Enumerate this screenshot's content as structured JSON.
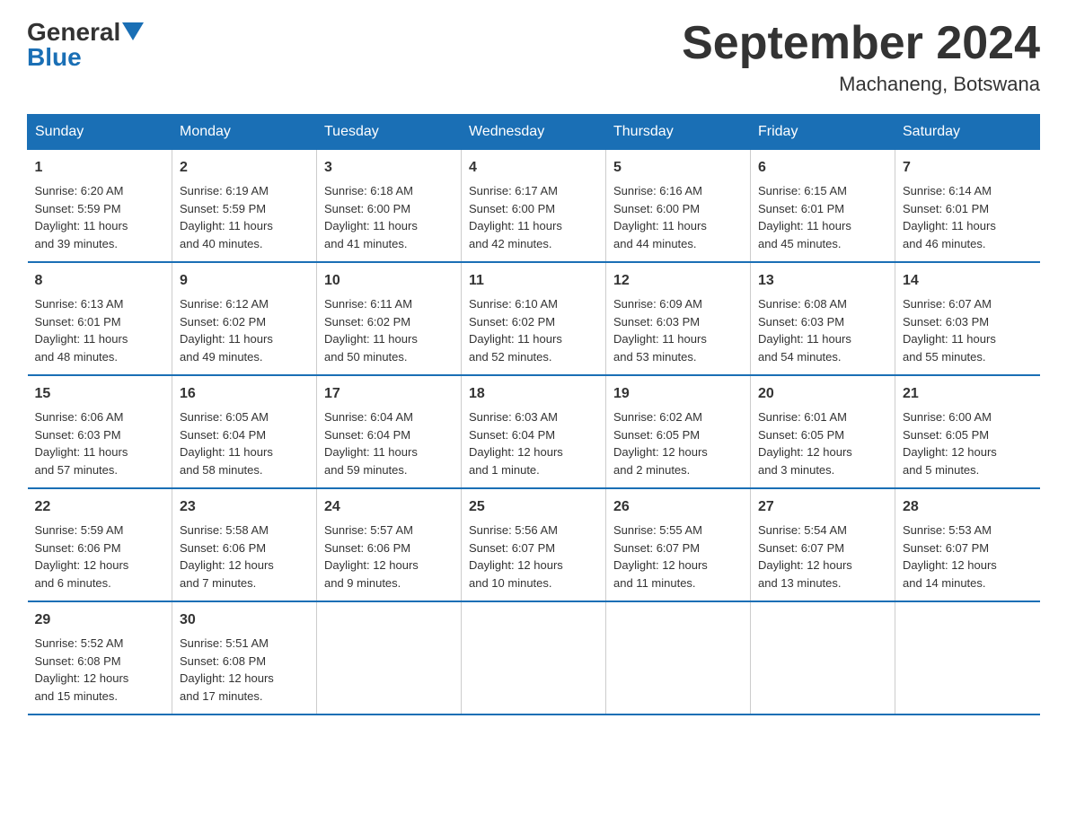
{
  "header": {
    "logo_general": "General",
    "logo_blue": "Blue",
    "month_title": "September 2024",
    "location": "Machaneng, Botswana"
  },
  "weekdays": [
    "Sunday",
    "Monday",
    "Tuesday",
    "Wednesday",
    "Thursday",
    "Friday",
    "Saturday"
  ],
  "weeks": [
    [
      {
        "day": "1",
        "sunrise": "6:20 AM",
        "sunset": "5:59 PM",
        "daylight": "11 hours and 39 minutes."
      },
      {
        "day": "2",
        "sunrise": "6:19 AM",
        "sunset": "5:59 PM",
        "daylight": "11 hours and 40 minutes."
      },
      {
        "day": "3",
        "sunrise": "6:18 AM",
        "sunset": "6:00 PM",
        "daylight": "11 hours and 41 minutes."
      },
      {
        "day": "4",
        "sunrise": "6:17 AM",
        "sunset": "6:00 PM",
        "daylight": "11 hours and 42 minutes."
      },
      {
        "day": "5",
        "sunrise": "6:16 AM",
        "sunset": "6:00 PM",
        "daylight": "11 hours and 44 minutes."
      },
      {
        "day": "6",
        "sunrise": "6:15 AM",
        "sunset": "6:01 PM",
        "daylight": "11 hours and 45 minutes."
      },
      {
        "day": "7",
        "sunrise": "6:14 AM",
        "sunset": "6:01 PM",
        "daylight": "11 hours and 46 minutes."
      }
    ],
    [
      {
        "day": "8",
        "sunrise": "6:13 AM",
        "sunset": "6:01 PM",
        "daylight": "11 hours and 48 minutes."
      },
      {
        "day": "9",
        "sunrise": "6:12 AM",
        "sunset": "6:02 PM",
        "daylight": "11 hours and 49 minutes."
      },
      {
        "day": "10",
        "sunrise": "6:11 AM",
        "sunset": "6:02 PM",
        "daylight": "11 hours and 50 minutes."
      },
      {
        "day": "11",
        "sunrise": "6:10 AM",
        "sunset": "6:02 PM",
        "daylight": "11 hours and 52 minutes."
      },
      {
        "day": "12",
        "sunrise": "6:09 AM",
        "sunset": "6:03 PM",
        "daylight": "11 hours and 53 minutes."
      },
      {
        "day": "13",
        "sunrise": "6:08 AM",
        "sunset": "6:03 PM",
        "daylight": "11 hours and 54 minutes."
      },
      {
        "day": "14",
        "sunrise": "6:07 AM",
        "sunset": "6:03 PM",
        "daylight": "11 hours and 55 minutes."
      }
    ],
    [
      {
        "day": "15",
        "sunrise": "6:06 AM",
        "sunset": "6:03 PM",
        "daylight": "11 hours and 57 minutes."
      },
      {
        "day": "16",
        "sunrise": "6:05 AM",
        "sunset": "6:04 PM",
        "daylight": "11 hours and 58 minutes."
      },
      {
        "day": "17",
        "sunrise": "6:04 AM",
        "sunset": "6:04 PM",
        "daylight": "11 hours and 59 minutes."
      },
      {
        "day": "18",
        "sunrise": "6:03 AM",
        "sunset": "6:04 PM",
        "daylight": "12 hours and 1 minute."
      },
      {
        "day": "19",
        "sunrise": "6:02 AM",
        "sunset": "6:05 PM",
        "daylight": "12 hours and 2 minutes."
      },
      {
        "day": "20",
        "sunrise": "6:01 AM",
        "sunset": "6:05 PM",
        "daylight": "12 hours and 3 minutes."
      },
      {
        "day": "21",
        "sunrise": "6:00 AM",
        "sunset": "6:05 PM",
        "daylight": "12 hours and 5 minutes."
      }
    ],
    [
      {
        "day": "22",
        "sunrise": "5:59 AM",
        "sunset": "6:06 PM",
        "daylight": "12 hours and 6 minutes."
      },
      {
        "day": "23",
        "sunrise": "5:58 AM",
        "sunset": "6:06 PM",
        "daylight": "12 hours and 7 minutes."
      },
      {
        "day": "24",
        "sunrise": "5:57 AM",
        "sunset": "6:06 PM",
        "daylight": "12 hours and 9 minutes."
      },
      {
        "day": "25",
        "sunrise": "5:56 AM",
        "sunset": "6:07 PM",
        "daylight": "12 hours and 10 minutes."
      },
      {
        "day": "26",
        "sunrise": "5:55 AM",
        "sunset": "6:07 PM",
        "daylight": "12 hours and 11 minutes."
      },
      {
        "day": "27",
        "sunrise": "5:54 AM",
        "sunset": "6:07 PM",
        "daylight": "12 hours and 13 minutes."
      },
      {
        "day": "28",
        "sunrise": "5:53 AM",
        "sunset": "6:07 PM",
        "daylight": "12 hours and 14 minutes."
      }
    ],
    [
      {
        "day": "29",
        "sunrise": "5:52 AM",
        "sunset": "6:08 PM",
        "daylight": "12 hours and 15 minutes."
      },
      {
        "day": "30",
        "sunrise": "5:51 AM",
        "sunset": "6:08 PM",
        "daylight": "12 hours and 17 minutes."
      },
      null,
      null,
      null,
      null,
      null
    ]
  ],
  "labels": {
    "sunrise": "Sunrise:",
    "sunset": "Sunset:",
    "daylight": "Daylight:"
  }
}
